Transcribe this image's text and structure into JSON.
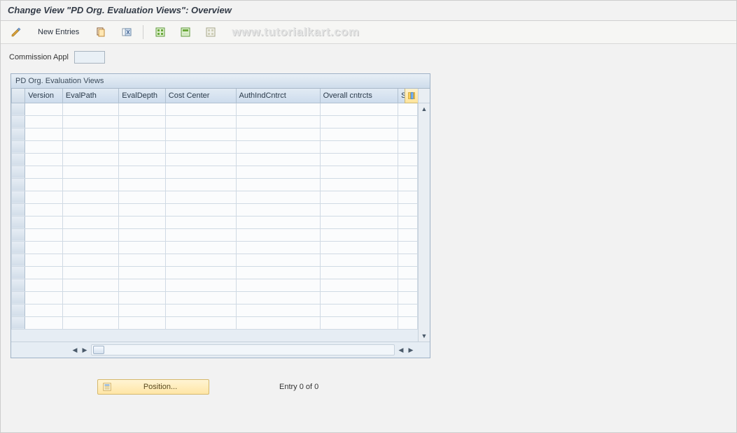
{
  "title": "Change View \"PD Org. Evaluation Views\": Overview",
  "toolbar": {
    "new_entries_label": "New Entries"
  },
  "watermark": "www.tutorialkart.com",
  "field": {
    "label": "Commission Appl",
    "value": ""
  },
  "grid": {
    "title": "PD Org. Evaluation Views",
    "columns": [
      "Version",
      "EvalPath",
      "EvalDepth",
      "Cost Center",
      "AuthIndCntrct",
      "Overall cntrcts",
      "Stat"
    ],
    "rows": [
      [
        "",
        "",
        "",
        "",
        "",
        "",
        ""
      ],
      [
        "",
        "",
        "",
        "",
        "",
        "",
        ""
      ],
      [
        "",
        "",
        "",
        "",
        "",
        "",
        ""
      ],
      [
        "",
        "",
        "",
        "",
        "",
        "",
        ""
      ],
      [
        "",
        "",
        "",
        "",
        "",
        "",
        ""
      ],
      [
        "",
        "",
        "",
        "",
        "",
        "",
        ""
      ],
      [
        "",
        "",
        "",
        "",
        "",
        "",
        ""
      ],
      [
        "",
        "",
        "",
        "",
        "",
        "",
        ""
      ],
      [
        "",
        "",
        "",
        "",
        "",
        "",
        ""
      ],
      [
        "",
        "",
        "",
        "",
        "",
        "",
        ""
      ],
      [
        "",
        "",
        "",
        "",
        "",
        "",
        ""
      ],
      [
        "",
        "",
        "",
        "",
        "",
        "",
        ""
      ],
      [
        "",
        "",
        "",
        "",
        "",
        "",
        ""
      ],
      [
        "",
        "",
        "",
        "",
        "",
        "",
        ""
      ],
      [
        "",
        "",
        "",
        "",
        "",
        "",
        ""
      ],
      [
        "",
        "",
        "",
        "",
        "",
        "",
        ""
      ],
      [
        "",
        "",
        "",
        "",
        "",
        "",
        ""
      ],
      [
        "",
        "",
        "",
        "",
        "",
        "",
        ""
      ]
    ]
  },
  "footer": {
    "position_label": "Position...",
    "entry_text": "Entry 0 of 0"
  }
}
